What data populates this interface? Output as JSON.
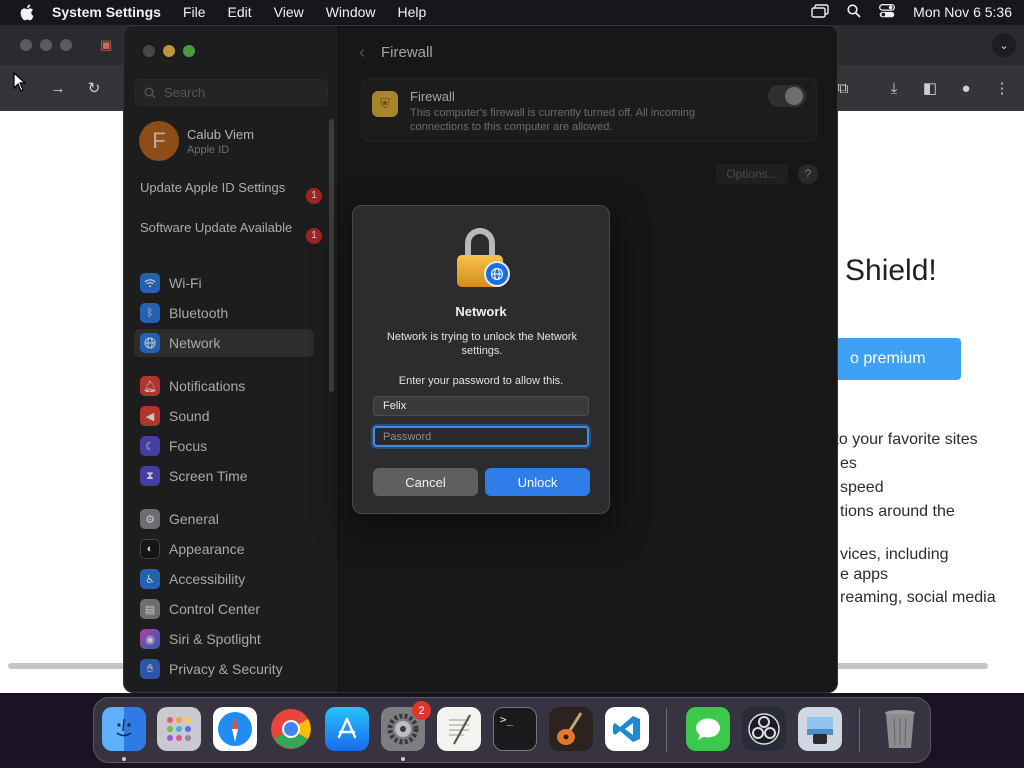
{
  "menubar": {
    "app_name": "System Settings",
    "menus": [
      "File",
      "Edit",
      "View",
      "Window",
      "Help"
    ],
    "datetime": "Mon Nov 6  5:36"
  },
  "browser_behind": {
    "heading_fragment": "Shield!",
    "button_fragment": "o premium",
    "lines": [
      "s to your favorite sites",
      "es",
      "speed",
      "tions around the",
      "vices, including",
      "e apps",
      "reaming, social media"
    ]
  },
  "settings": {
    "search_placeholder": "Search",
    "account": {
      "initial": "F",
      "name": "Calub Viem",
      "subtitle": "Apple ID"
    },
    "notices": [
      {
        "label": "Update Apple ID Settings",
        "badge": "1"
      },
      {
        "label": "Software Update Available",
        "badge": "1"
      }
    ],
    "sidebar_items": [
      {
        "label": "Wi-Fi",
        "icon": "wifi-icon",
        "color": "#2f7de1"
      },
      {
        "label": "Bluetooth",
        "icon": "bluetooth-icon",
        "color": "#2f7de1"
      },
      {
        "label": "Network",
        "icon": "network-globe-icon",
        "color": "#2f7de1"
      },
      {
        "label": "Notifications",
        "icon": "bell-icon",
        "color": "#e0453a"
      },
      {
        "label": "Sound",
        "icon": "speaker-icon",
        "color": "#e0453a"
      },
      {
        "label": "Focus",
        "icon": "moon-icon",
        "color": "#5a4fd1"
      },
      {
        "label": "Screen Time",
        "icon": "hourglass-icon",
        "color": "#5a4fd1"
      },
      {
        "label": "General",
        "icon": "gear-icon",
        "color": "#8e8e93"
      },
      {
        "label": "Appearance",
        "icon": "appearance-icon",
        "color": "#1c1c1e"
      },
      {
        "label": "Accessibility",
        "icon": "accessibility-icon",
        "color": "#2f7de1"
      },
      {
        "label": "Control Center",
        "icon": "control-center-icon",
        "color": "#8e8e93"
      },
      {
        "label": "Siri & Spotlight",
        "icon": "siri-icon",
        "color": "#b94bd6"
      },
      {
        "label": "Privacy & Security",
        "icon": "hand-icon",
        "color": "#3a6fd8"
      }
    ],
    "content": {
      "title": "Firewall",
      "firewall_label": "Firewall",
      "firewall_desc": "This computer's firewall is currently turned off. All incoming connections to this computer are allowed.",
      "firewall_on": false,
      "options_label": "Options...",
      "help_label": "?"
    }
  },
  "dialog": {
    "title": "Network",
    "message": "Network is trying to unlock the Network settings.",
    "prompt": "Enter your password to allow this.",
    "username": "Felix",
    "password_placeholder": "Password",
    "cancel_label": "Cancel",
    "unlock_label": "Unlock"
  },
  "dock": {
    "apps": [
      "Finder",
      "Launchpad",
      "Safari",
      "Google Chrome",
      "App Store",
      "System Settings",
      "TextEdit",
      "Terminal",
      "GarageBand",
      "Visual Studio Code",
      "Messages",
      "OBS",
      "Preview",
      "Trash"
    ],
    "settings_badge": "2",
    "terminal_glyph": ">_"
  }
}
